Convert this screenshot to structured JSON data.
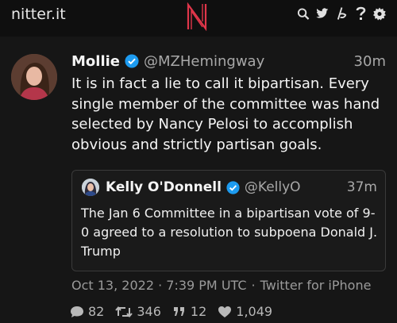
{
  "nav": {
    "brand": "nitter.it",
    "logo_letter": "N",
    "icons": [
      "search-icon",
      "twitter-icon",
      "rss-icon",
      "help-icon",
      "settings-icon"
    ]
  },
  "tweet": {
    "display_name": "Mollie",
    "handle": "@MZHemingway",
    "time": "30m",
    "text": "It is in fact a lie to call it bipartisan. Every single member of the committee was hand selected by Nancy Pelosi to accomplish obvious and strictly partisan goals.",
    "date": "Oct 13, 2022 · 7:39 PM UTC",
    "source": "Twitter for iPhone",
    "stats": {
      "replies": "82",
      "retweets": "346",
      "quotes": "12",
      "likes": "1,049"
    }
  },
  "quote": {
    "display_name": "Kelly O'Donnell",
    "handle": "@KellyO",
    "time": "37m",
    "text": "The Jan 6 Committee in a bipartisan vote of 9-0 agreed to a resolution to subpoena Donald J. Trump"
  },
  "colors": {
    "accent_red": "#e0364a",
    "verified_blue": "#1d9bf0",
    "background": "#161616",
    "muted_text": "#a8a8a8"
  }
}
